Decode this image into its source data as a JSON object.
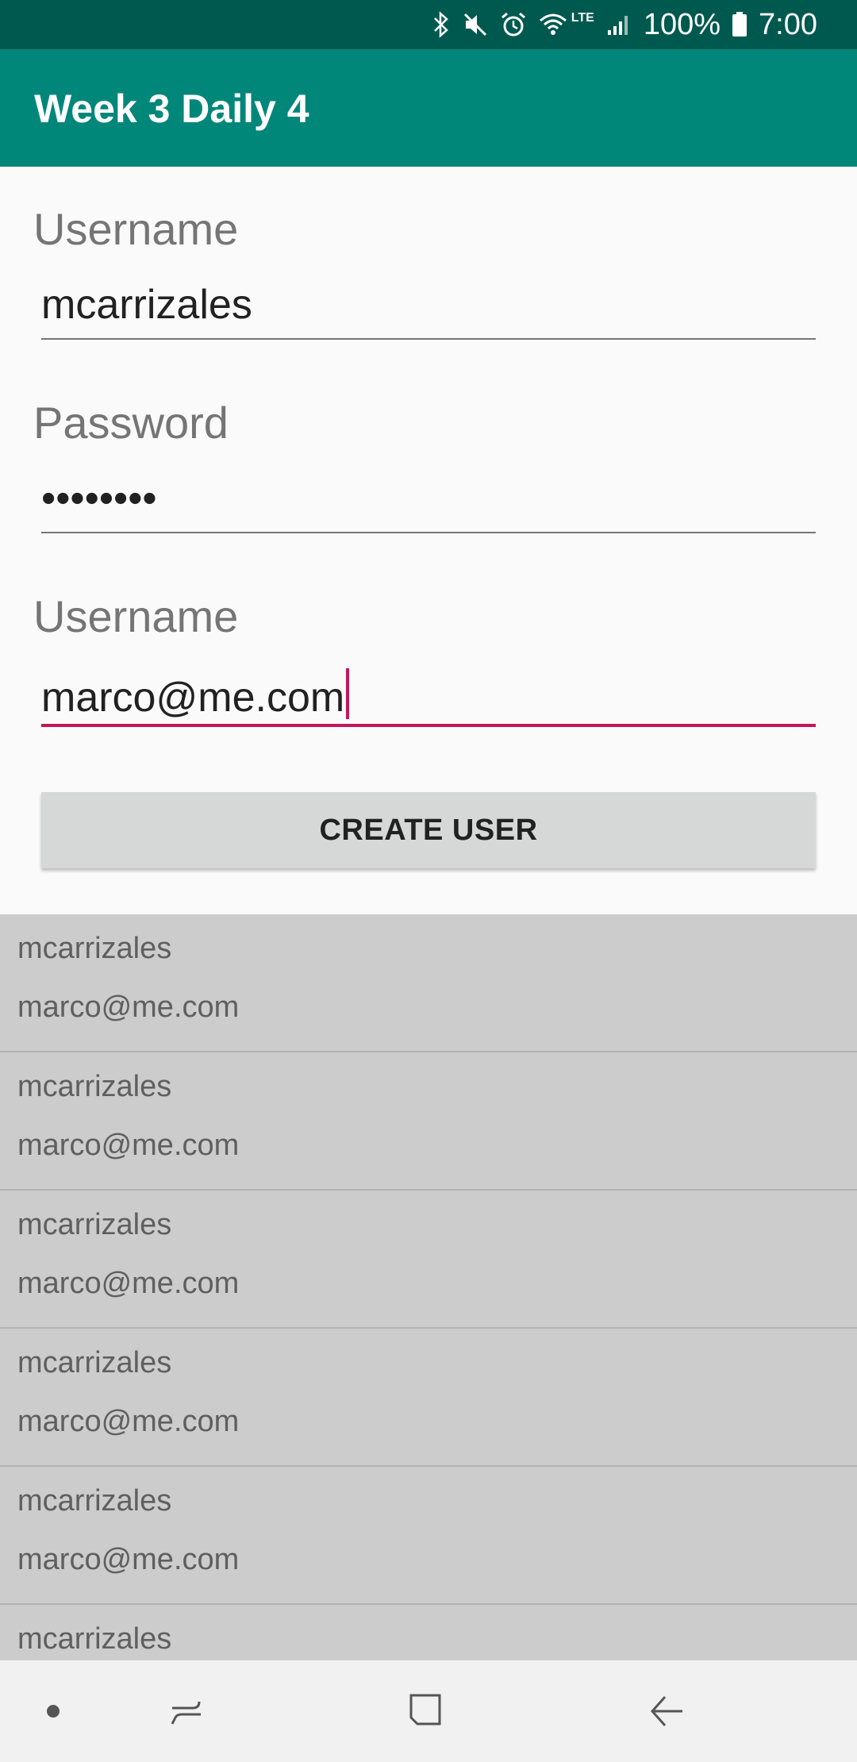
{
  "status_bar": {
    "icons": [
      "bluetooth-icon",
      "mute-icon",
      "alarm-icon",
      "wifi-icon",
      "signal-icon",
      "battery-icon"
    ],
    "lte_label": "LTE",
    "battery": "100%",
    "time": "7:00"
  },
  "app_bar": {
    "title": "Week 3 Daily 4"
  },
  "form": {
    "username_label": "Username",
    "username_value": "mcarrizales",
    "password_label": "Password",
    "password_value": "••••••••",
    "email_label": "Username",
    "email_value": "marco@me.com",
    "create_button": "CREATE USER"
  },
  "users": [
    {
      "username": "mcarrizales",
      "email": "marco@me.com"
    },
    {
      "username": "mcarrizales",
      "email": "marco@me.com"
    },
    {
      "username": "mcarrizales",
      "email": "marco@me.com"
    },
    {
      "username": "mcarrizales",
      "email": "marco@me.com"
    },
    {
      "username": "mcarrizales",
      "email": "marco@me.com"
    },
    {
      "username": "mcarrizales",
      "email": ""
    }
  ],
  "nav_bar": {
    "icons": [
      "dot-icon",
      "recents-icon",
      "home-icon",
      "back-icon"
    ]
  },
  "colors": {
    "status_bar": "#00594f",
    "app_bar": "#00877a",
    "accent": "#c2185b",
    "list_bg": "#cccccc"
  }
}
